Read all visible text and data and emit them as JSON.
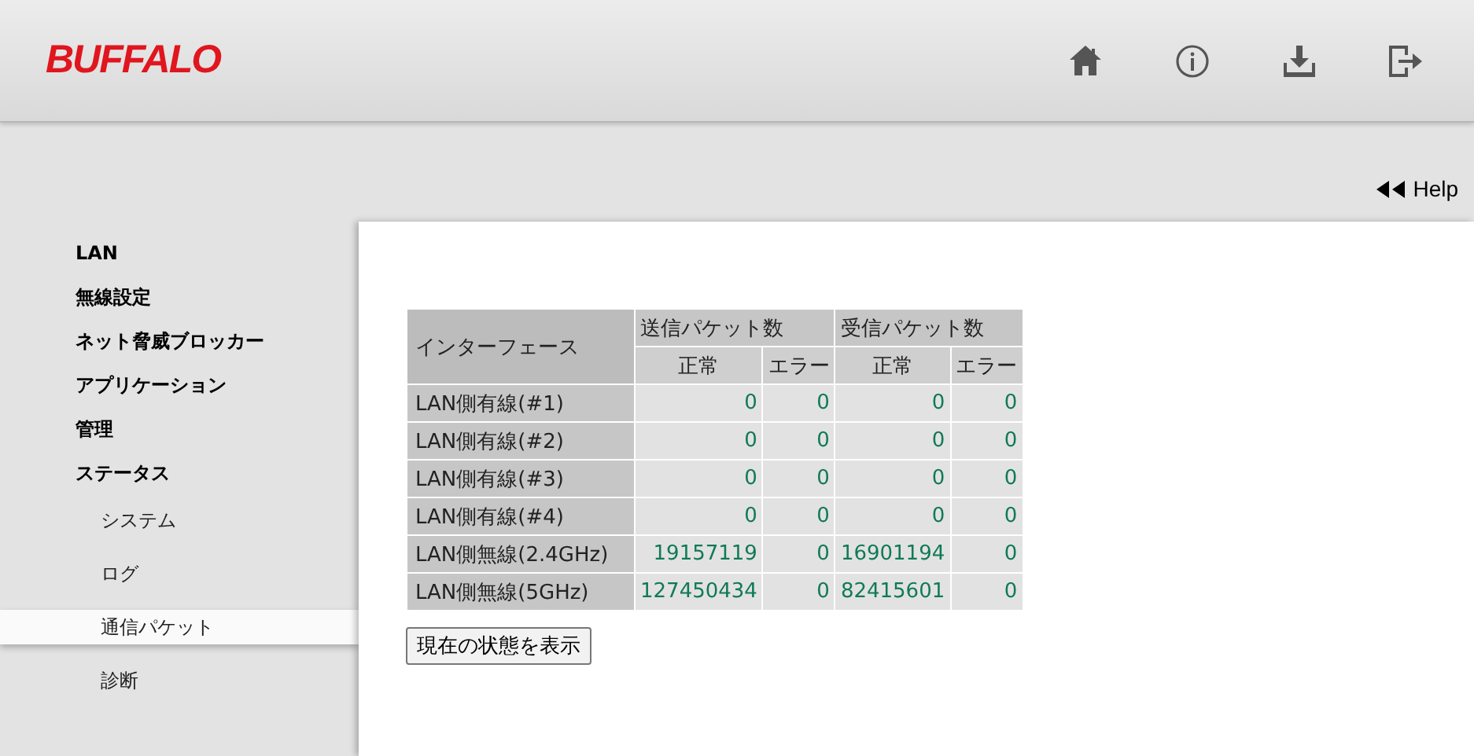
{
  "header": {
    "logo": "BUFFALO"
  },
  "help_link": {
    "label": "Help"
  },
  "sidebar": {
    "items": [
      {
        "label": "LAN",
        "selected": false
      },
      {
        "label": "無線設定",
        "selected": false
      },
      {
        "label": "ネット脅威ブロッカー",
        "selected": false
      },
      {
        "label": "アプリケーション",
        "selected": false
      },
      {
        "label": "管理",
        "selected": false
      },
      {
        "label": "ステータス",
        "selected": false,
        "children": [
          {
            "label": "システム",
            "selected": false
          },
          {
            "label": "ログ",
            "selected": false
          },
          {
            "label": "通信パケット",
            "selected": true
          },
          {
            "label": "診断",
            "selected": false
          }
        ]
      }
    ]
  },
  "table": {
    "interface_header": "インターフェース",
    "group_headers": [
      "送信パケット数",
      "受信パケット数"
    ],
    "sub_headers": [
      "正常",
      "エラー",
      "正常",
      "エラー"
    ],
    "rows": [
      {
        "interface": "LAN側有線(#1)",
        "cells": [
          "0",
          "0",
          "0",
          "0"
        ]
      },
      {
        "interface": "LAN側有線(#2)",
        "cells": [
          "0",
          "0",
          "0",
          "0"
        ]
      },
      {
        "interface": "LAN側有線(#3)",
        "cells": [
          "0",
          "0",
          "0",
          "0"
        ]
      },
      {
        "interface": "LAN側有線(#4)",
        "cells": [
          "0",
          "0",
          "0",
          "0"
        ]
      },
      {
        "interface": "LAN側無線(2.4GHz)",
        "cells": [
          "19157119",
          "0",
          "16901194",
          "0"
        ]
      },
      {
        "interface": "LAN側無線(5GHz)",
        "cells": [
          "127450434",
          "0",
          "82415601",
          "0"
        ]
      }
    ]
  },
  "refresh_button": {
    "label": "現在の状態を表示"
  }
}
